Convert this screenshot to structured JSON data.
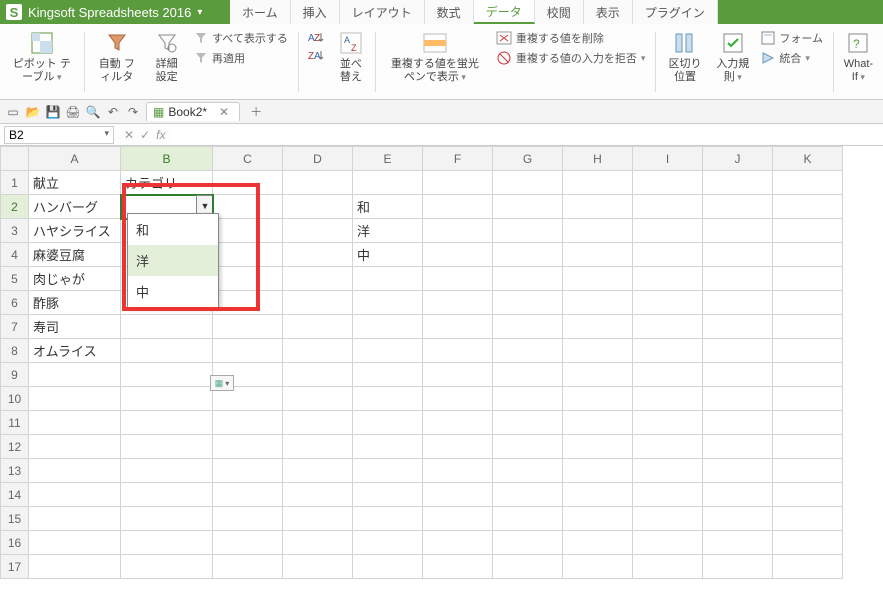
{
  "app": {
    "title": "Kingsoft Spreadsheets 2016"
  },
  "menu": {
    "tabs": [
      "ホーム",
      "挿入",
      "レイアウト",
      "数式",
      "データ",
      "校閲",
      "表示",
      "プラグイン"
    ],
    "active_index": 4
  },
  "ribbon": {
    "pivot": "ピボット\nテーブル",
    "autofilter": "自動\nフィルタ",
    "detail": "詳細\n設定",
    "show_all": "すべて表示する",
    "reapply": "再適用",
    "sort_asc": "昇順",
    "sort_desc": "降順",
    "sort": "並べ替え",
    "highlight_dup": "重複する値を蛍光ペンで表示",
    "remove_dup": "重複する値を削除",
    "reject_dup": "重複する値の入力を拒否",
    "text_to_col": "区切り\n位置",
    "validation": "入力規則",
    "form": "フォーム",
    "consolidate": "統合",
    "whatif": "What-If"
  },
  "doc": {
    "name": "Book2*"
  },
  "namebox": {
    "value": "B2"
  },
  "columns": [
    "A",
    "B",
    "C",
    "D",
    "E",
    "F",
    "G",
    "H",
    "I",
    "J",
    "K"
  ],
  "rows": [
    "1",
    "2",
    "3",
    "4",
    "5",
    "6",
    "7",
    "8",
    "9",
    "10",
    "11",
    "12",
    "13",
    "14",
    "15",
    "16",
    "17"
  ],
  "cells": {
    "A1": "献立",
    "B1": "カテゴリ",
    "A2": "ハンバーグ",
    "A3": "ハヤシライス",
    "A4": "麻婆豆腐",
    "A5": "肉じゃが",
    "A6": "酢豚",
    "A7": "寿司",
    "A8": "オムライス",
    "E2": "和",
    "E3": "洋",
    "E4": "中"
  },
  "dropdown": {
    "items": [
      "和",
      "洋",
      "中"
    ],
    "highlight_index": 1
  },
  "smart_tag": "▦"
}
